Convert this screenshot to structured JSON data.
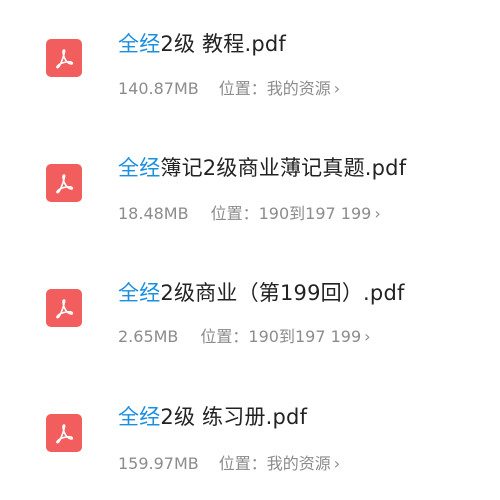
{
  "files": [
    {
      "highlight": "全经",
      "name_rest": "2级 教程.pdf",
      "size": "140.87MB",
      "location_label": "位置：",
      "location": "我的资源",
      "chevron": "›"
    },
    {
      "highlight": "全经",
      "name_rest": "簿记2级商业薄记真题.pdf",
      "size": "18.48MB",
      "location_label": "位置：",
      "location": "190到197 199",
      "chevron": "›"
    },
    {
      "highlight": "全经",
      "name_rest": "2级商业（第199回）.pdf",
      "size": "2.65MB",
      "location_label": "位置：",
      "location": "190到197 199",
      "chevron": "›"
    },
    {
      "highlight": "全经",
      "name_rest": "2级 练习册.pdf",
      "size": "159.97MB",
      "location_label": "位置：",
      "location": "我的资源",
      "chevron": "›"
    }
  ],
  "colors": {
    "highlight": "#1a8fe0",
    "pdf_icon": "#f25d5d",
    "title": "#222222",
    "meta": "#8c8c8c"
  },
  "icons": {
    "file_type": "pdf-icon",
    "navigate": "chevron-right-icon"
  }
}
